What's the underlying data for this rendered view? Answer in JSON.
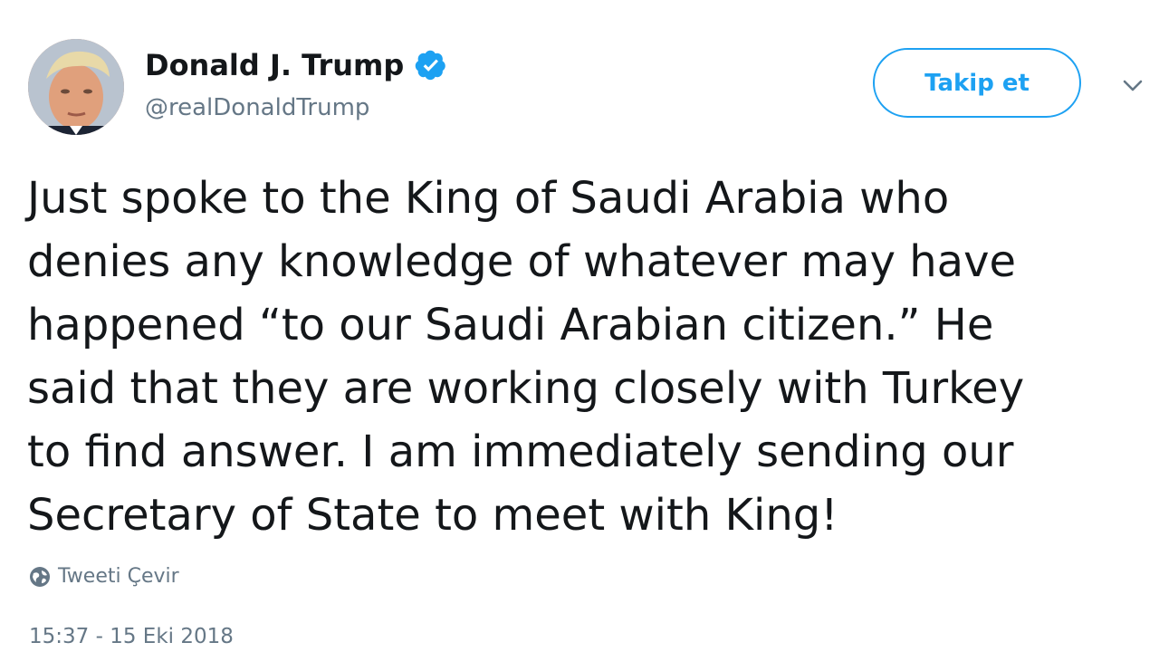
{
  "user": {
    "display_name": "Donald J. Trump",
    "handle": "@realDonaldTrump",
    "verified": true,
    "avatar_icon": "profile-avatar"
  },
  "actions": {
    "follow_label": "Takip et",
    "menu_icon": "chevron-down-icon"
  },
  "tweet": {
    "text": "Just spoke to the King of Saudi Arabia who\ndenies any knowledge of whatever may have\nhappened “to our Saudi Arabian citizen.” He\nsaid that they are working closely with Turkey\nto find answer. I am immediately sending our\nSecretary of State to meet with King!",
    "translate_label": "Tweeti Çevir",
    "translate_icon": "globe-icon",
    "timestamp": "15:37 - 15 Eki 2018"
  },
  "colors": {
    "accent": "#1da1f2",
    "text": "#14171a",
    "muted": "#657786"
  }
}
